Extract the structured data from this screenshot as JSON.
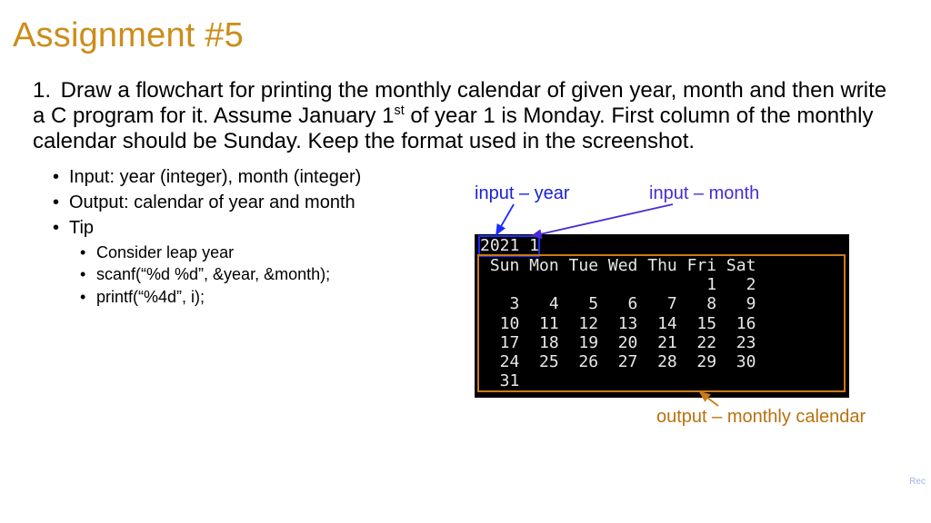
{
  "title": "Assignment #5",
  "task": {
    "number": "1.",
    "text_html": "Draw a flowchart for printing the monthly calendar of given year, month and then write a C program for it. Assume January 1<span class=\"sup\">st</span> of year 1 is Monday. First column of the monthly calendar should be Sunday. Keep the format used in the screenshot."
  },
  "bullets": {
    "input": "Input: year (integer), month (integer)",
    "output": "Output: calendar of year and month",
    "tip_label": "Tip",
    "tips": {
      "leap": "Consider leap year",
      "scanf": "scanf(“%d %d”, &year, &month);",
      "printf": "printf(“%4d”, i);"
    }
  },
  "terminal": {
    "input_line": "2021 1",
    "header": " Sun Mon Tue Wed Thu Fri Sat",
    "rows": [
      "                       1   2",
      "   3   4   5   6   7   8   9",
      "  10  11  12  13  14  15  16",
      "  17  18  19  20  21  22  23",
      "  24  25  26  27  28  29  30",
      "  31"
    ]
  },
  "captions": {
    "year": "input – year",
    "month": "input – month",
    "output": "output – monthly calendar"
  },
  "rec_label": "Rec",
  "chart_data": {
    "type": "table",
    "title": "January 2021 monthly calendar (first column Sunday)",
    "columns": [
      "Sun",
      "Mon",
      "Tue",
      "Wed",
      "Thu",
      "Fri",
      "Sat"
    ],
    "year": 2021,
    "month": 1,
    "rows": [
      [
        null,
        null,
        null,
        null,
        null,
        1,
        2
      ],
      [
        3,
        4,
        5,
        6,
        7,
        8,
        9
      ],
      [
        10,
        11,
        12,
        13,
        14,
        15,
        16
      ],
      [
        17,
        18,
        19,
        20,
        21,
        22,
        23
      ],
      [
        24,
        25,
        26,
        27,
        28,
        29,
        30
      ],
      [
        31,
        null,
        null,
        null,
        null,
        null,
        null
      ]
    ]
  },
  "colors": {
    "title": "#cc8d1a",
    "blue_box": "#1a2cff",
    "orange_box": "#cc7a14",
    "caption_blue": "#1a23d3",
    "caption_purple": "#4a2bd6",
    "caption_orange": "#b9710e"
  }
}
